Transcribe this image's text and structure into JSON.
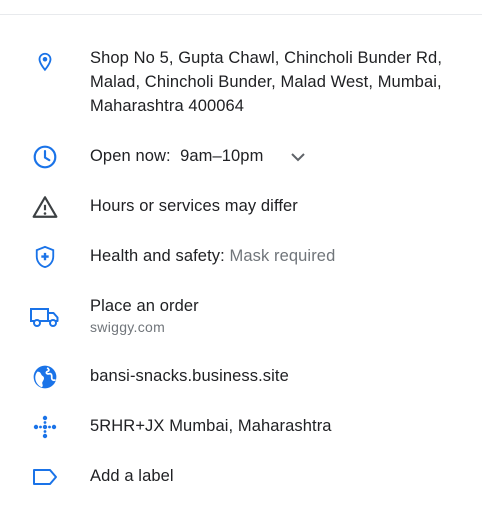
{
  "address": {
    "line1": "Shop No 5, Gupta Chawl, Chincholi Bunder Rd,",
    "line2": "Malad, Chincholi Bunder, Malad West, Mumbai,",
    "line3": "Maharashtra 400064",
    "icon": "location-pin-icon"
  },
  "hours": {
    "label": "Open now:",
    "value": "9am–10pm",
    "icon": "clock-icon"
  },
  "notice": {
    "text": "Hours or services may differ",
    "icon": "warning-icon"
  },
  "health": {
    "label": "Health and safety:",
    "value": "Mask required",
    "icon": "health-shield-icon"
  },
  "order": {
    "label": "Place an order",
    "provider": "swiggy.com",
    "icon": "delivery-truck-icon"
  },
  "website": {
    "url": "bansi-snacks.business.site",
    "icon": "globe-icon"
  },
  "plus_code": {
    "text": "5RHR+JX Mumbai, Maharashtra",
    "icon": "plus-code-icon"
  },
  "label": {
    "text": "Add a label",
    "icon": "label-tag-icon"
  },
  "colors": {
    "accent": "#1a73e8",
    "text": "#202124",
    "muted": "#70757a",
    "divider": "#e8eaed"
  }
}
